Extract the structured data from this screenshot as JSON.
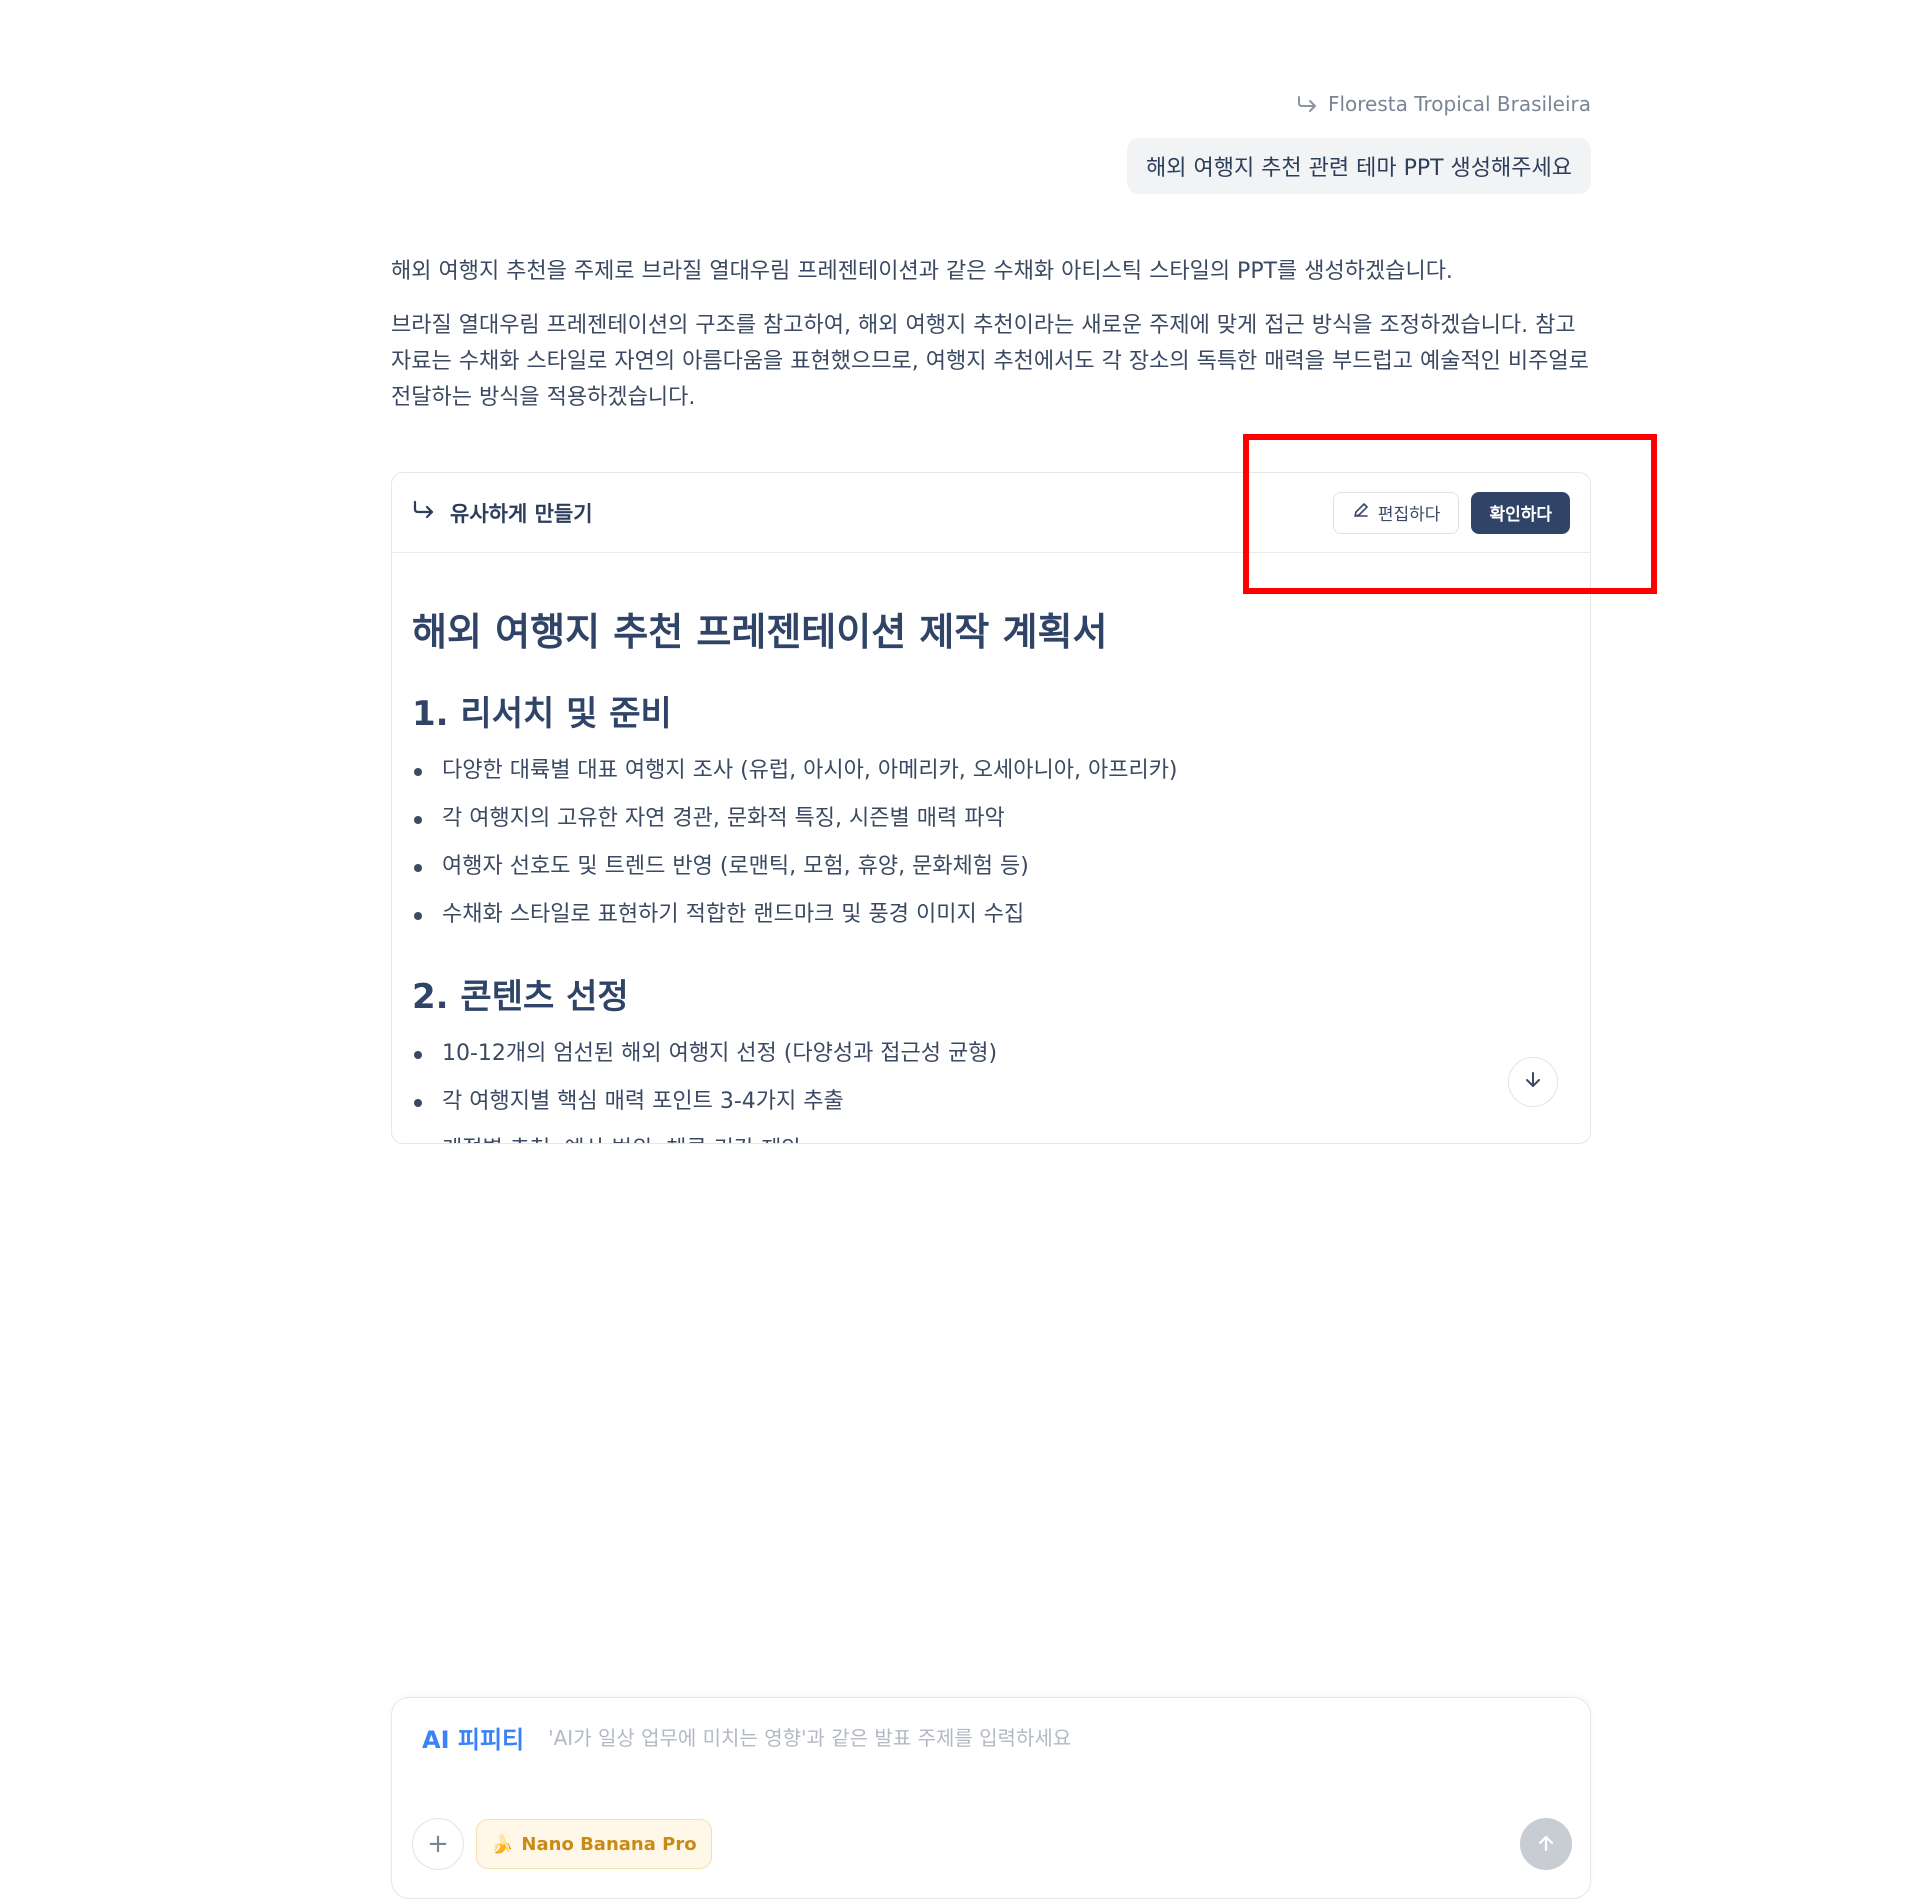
{
  "chat": {
    "reference_label": "Floresta Tropical Brasileira",
    "user_message": "해외 여행지 추천 관련 테마 PPT 생성해주세요",
    "assistant_paragraphs": [
      "해외 여행지 추천을 주제로 브라질 열대우림 프레젠테이션과 같은 수채화 아티스틱 스타일의 PPT를 생성하겠습니다.",
      "브라질 열대우림 프레젠테이션의 구조를 참고하여, 해외 여행지 추천이라는 새로운 주제에 맞게 접근 방식을 조정하겠습니다. 참고 자료는 수채화 스타일로 자연의 아름다움을 표현했으므로, 여행지 추천에서도 각 장소의 독특한 매력을 부드럽고 예술적인 비주얼로 전달하는 방식을 적용하겠습니다."
    ]
  },
  "plan_card": {
    "header_title": "유사하게 만들기",
    "edit_label": "편집하다",
    "confirm_label": "확인하다",
    "doc_title": "해외 여행지 추천 프레젠테이션 제작 계획서",
    "sections": [
      {
        "heading": "1. 리서치 및 준비",
        "items": [
          "다양한 대륙별 대표 여행지 조사 (유럽, 아시아, 아메리카, 오세아니아, 아프리카)",
          "각 여행지의 고유한 자연 경관, 문화적 특징, 시즌별 매력 파악",
          "여행자 선호도 및 트렌드 반영 (로맨틱, 모험, 휴양, 문화체험 등)",
          "수채화 스타일로 표현하기 적합한 랜드마크 및 풍경 이미지 수집"
        ]
      },
      {
        "heading": "2. 콘텐츠 선정",
        "items": [
          "10-12개의 엄선된 해외 여행지 선정 (다양성과 접근성 균형)",
          "각 여행지별 핵심 매력 포인트 3-4가지 추출",
          "계절별 추천, 예산 범위, 체류 기간 제안"
        ]
      }
    ]
  },
  "composer": {
    "brand": "AI 피피티",
    "placeholder": "'AI가 일상 업무에 미치는 영향'과 같은 발표 주제를 입력하세요",
    "model_chip": "Nano Banana Pro",
    "model_icon": "banana-emoji"
  },
  "colors": {
    "primary": "#2f4467",
    "highlight": "#ff0000",
    "brand_blue": "#3b82f6"
  }
}
